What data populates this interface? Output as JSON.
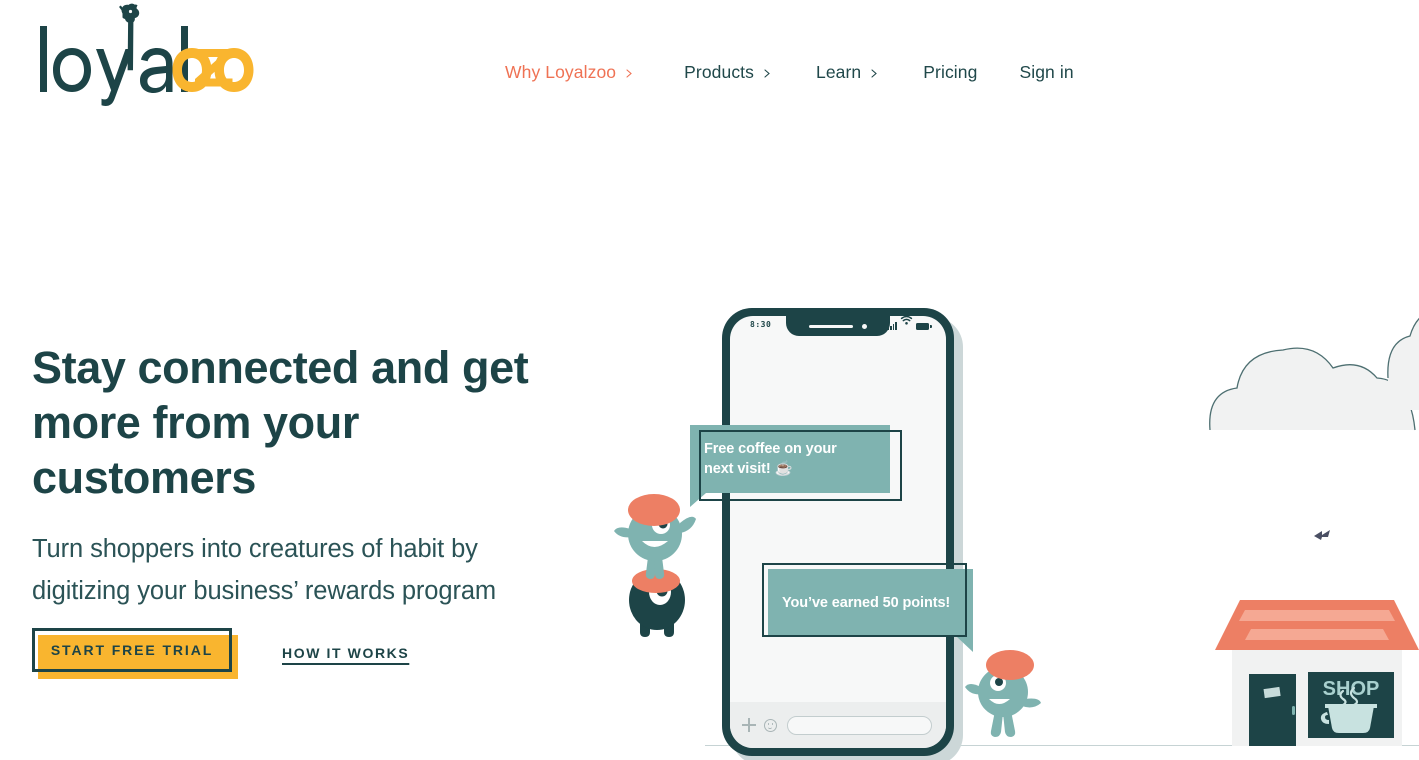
{
  "brand": {
    "name": "loyalzoo",
    "name_part_1": "loyal",
    "name_part_2": "zoo",
    "logo_colors": {
      "dark": "#1d4447",
      "yellow": "#f9b52f"
    }
  },
  "nav": {
    "items": [
      {
        "label": "Why Loyalzoo",
        "has_chevron": true,
        "active": true
      },
      {
        "label": "Products",
        "has_chevron": true,
        "active": false
      },
      {
        "label": "Learn",
        "has_chevron": true,
        "active": false
      },
      {
        "label": "Pricing",
        "has_chevron": false,
        "active": false
      },
      {
        "label": "Sign in",
        "has_chevron": false,
        "active": false
      }
    ],
    "chevron_icon": "chevron-right-icon",
    "active_color": "#ef7254",
    "default_color": "#20484a"
  },
  "hero": {
    "headline": "Stay connected and get more from your customers",
    "subheadline": "Turn shoppers into creatures of habit by digitizing your business’ rewards program",
    "primary_cta": "START FREE TRIAL",
    "secondary_cta": "HOW IT WORKS",
    "primary_cta_color": "#f9b52f",
    "text_color": "#1d4447"
  },
  "phone": {
    "status_time": "8:30",
    "status_icons": [
      "signal-bars-icon",
      "wifi-icon",
      "battery-icon"
    ],
    "chat_bar_icons": [
      "plus-icon",
      "smiley-icon"
    ],
    "chat_input_placeholder": ""
  },
  "bubbles": [
    {
      "text": "Free coffee on your next visit! ☕",
      "line_1": "Free coffee on your",
      "line_2": "next visit! ☕"
    },
    {
      "text": "You’ve earned 50 points!"
    }
  ],
  "scene": {
    "shop_sign_text": "SHOP",
    "shop_icons": [
      "coffee-cup-icon",
      "door-icon"
    ],
    "decorations": [
      "cloud-icon",
      "cloud-icon",
      "bird-icon"
    ],
    "creatures": [
      "creature-teal-icon",
      "creature-dark-icon",
      "creature-teal-small-icon"
    ],
    "colors": {
      "teal": "#7fb3b0",
      "dark_teal": "#1d4447",
      "coral": "#ed7f64",
      "cloud": "#f1f2f2",
      "ground": "#c6d3d4"
    }
  }
}
